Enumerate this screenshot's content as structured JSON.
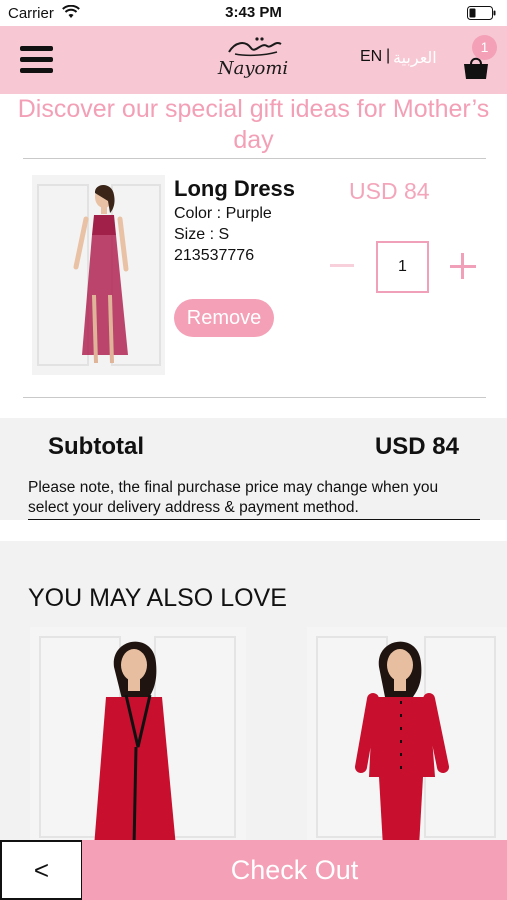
{
  "status_bar": {
    "carrier": "Carrier",
    "time": "3:43 PM"
  },
  "header": {
    "logo_text": "Nayomi",
    "lang_en": "EN",
    "lang_separator": "|",
    "lang_ar": "العربية",
    "cart_count": "1"
  },
  "promo_banner": "Discover our special gift ideas for Mother’s day",
  "cart_item": {
    "name": "Long Dress",
    "price": "USD 84",
    "color": "Color : Purple",
    "size": "Size : S",
    "sku": "213537776",
    "quantity": "1",
    "remove_label": "Remove"
  },
  "subtotal": {
    "label": "Subtotal",
    "value": "USD 84",
    "note": "Please note, the final purchase price may change when you select your delivery address & payment method."
  },
  "recommendations": {
    "title": "YOU MAY ALSO LOVE"
  },
  "footer": {
    "back_label": "<",
    "checkout_label": "Check Out"
  },
  "colors": {
    "brand_pink": "#f4a0b7",
    "header_pink": "#f7c7d3",
    "product_red": "#c8102e",
    "product_purple": "#a0204a"
  }
}
